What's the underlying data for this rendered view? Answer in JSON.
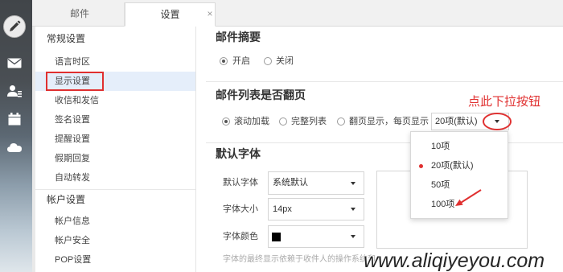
{
  "window": {
    "tabs": [
      {
        "label": "邮件",
        "active": false
      },
      {
        "label": "设置",
        "active": true
      }
    ],
    "close_glyph": "×"
  },
  "rail": {
    "icons": [
      "pencil-icon",
      "mail-icon",
      "contacts-icon",
      "calendar-icon",
      "cloud-icon"
    ]
  },
  "sidebar": {
    "sections": [
      {
        "title": "常规设置",
        "items": [
          {
            "label": "语言时区",
            "selected": false
          },
          {
            "label": "显示设置",
            "selected": true
          },
          {
            "label": "收信和发信",
            "selected": false
          },
          {
            "label": "签名设置",
            "selected": false
          },
          {
            "label": "提醒设置",
            "selected": false
          },
          {
            "label": "假期回复",
            "selected": false
          },
          {
            "label": "自动转发",
            "selected": false
          }
        ]
      },
      {
        "title": "帐户设置",
        "items": [
          {
            "label": "帐户信息",
            "selected": false
          },
          {
            "label": "帐户安全",
            "selected": false
          },
          {
            "label": "POP设置",
            "selected": false
          }
        ]
      }
    ]
  },
  "mail_summary": {
    "title": "邮件摘要",
    "options": [
      {
        "label": "开启",
        "checked": true
      },
      {
        "label": "关闭",
        "checked": false
      }
    ]
  },
  "mail_paging": {
    "title": "邮件列表是否翻页",
    "options": [
      {
        "label": "滚动加载",
        "checked": true
      },
      {
        "label": "完整列表",
        "checked": false
      },
      {
        "label": "翻页显示，每页显示",
        "checked": false
      }
    ],
    "page_size_select": {
      "value": "20项(默认)",
      "open": true,
      "options": [
        {
          "label": "10项",
          "selected": false
        },
        {
          "label": "20项(默认)",
          "selected": true
        },
        {
          "label": "50项",
          "selected": false
        },
        {
          "label": "100项",
          "selected": false
        }
      ]
    }
  },
  "default_font": {
    "title": "默认字体",
    "family": {
      "label": "默认字体",
      "value": "系统默认"
    },
    "size": {
      "label": "字体大小",
      "value": "14px"
    },
    "color": {
      "label": "字体颜色",
      "value": "#000000"
    },
    "note": "字体的最终显示依赖于收件人的操作系统和"
  },
  "annotation": {
    "text": "点此下拉按钮",
    "color": "#e03030"
  },
  "watermark": "www.aliqiyeyou.com",
  "colors": {
    "accent_red": "#e03030",
    "selected_bg": "#e5eefa",
    "text": "#333333",
    "rail_top": "#414549"
  }
}
